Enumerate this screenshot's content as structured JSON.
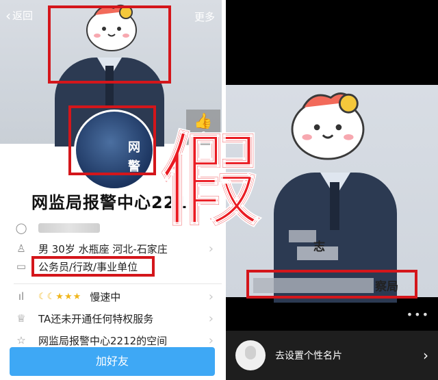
{
  "left_screen": {
    "header": {
      "back_label": "返回",
      "more_label": "更多"
    },
    "avatar_text": [
      "网",
      "警"
    ],
    "like_count": "6",
    "nickname": "网监局报警中心2212",
    "info_rows": [
      {
        "icon": "qq-icon",
        "text": ""
      },
      {
        "icon": "person-icon",
        "text": "男 30岁 水瓶座 河北-石家庄"
      },
      {
        "icon": "briefcase-icon",
        "text": "公务员/行政/事业单位"
      },
      {
        "icon": "level-icon",
        "text": "慢速中"
      },
      {
        "icon": "crown-icon",
        "text": "TA还未开通任何特权服务"
      },
      {
        "icon": "star-icon",
        "text": "网监局报警中心2212的空间"
      }
    ],
    "add_friend_label": "加好友"
  },
  "overlay_char": "假",
  "right_screen": {
    "name_fragment": "志",
    "org_fragment": "察局",
    "footer_label": "去设置个性名片"
  },
  "colors": {
    "highlight_red": "#d4161b",
    "button_blue": "#3ea8f5"
  }
}
